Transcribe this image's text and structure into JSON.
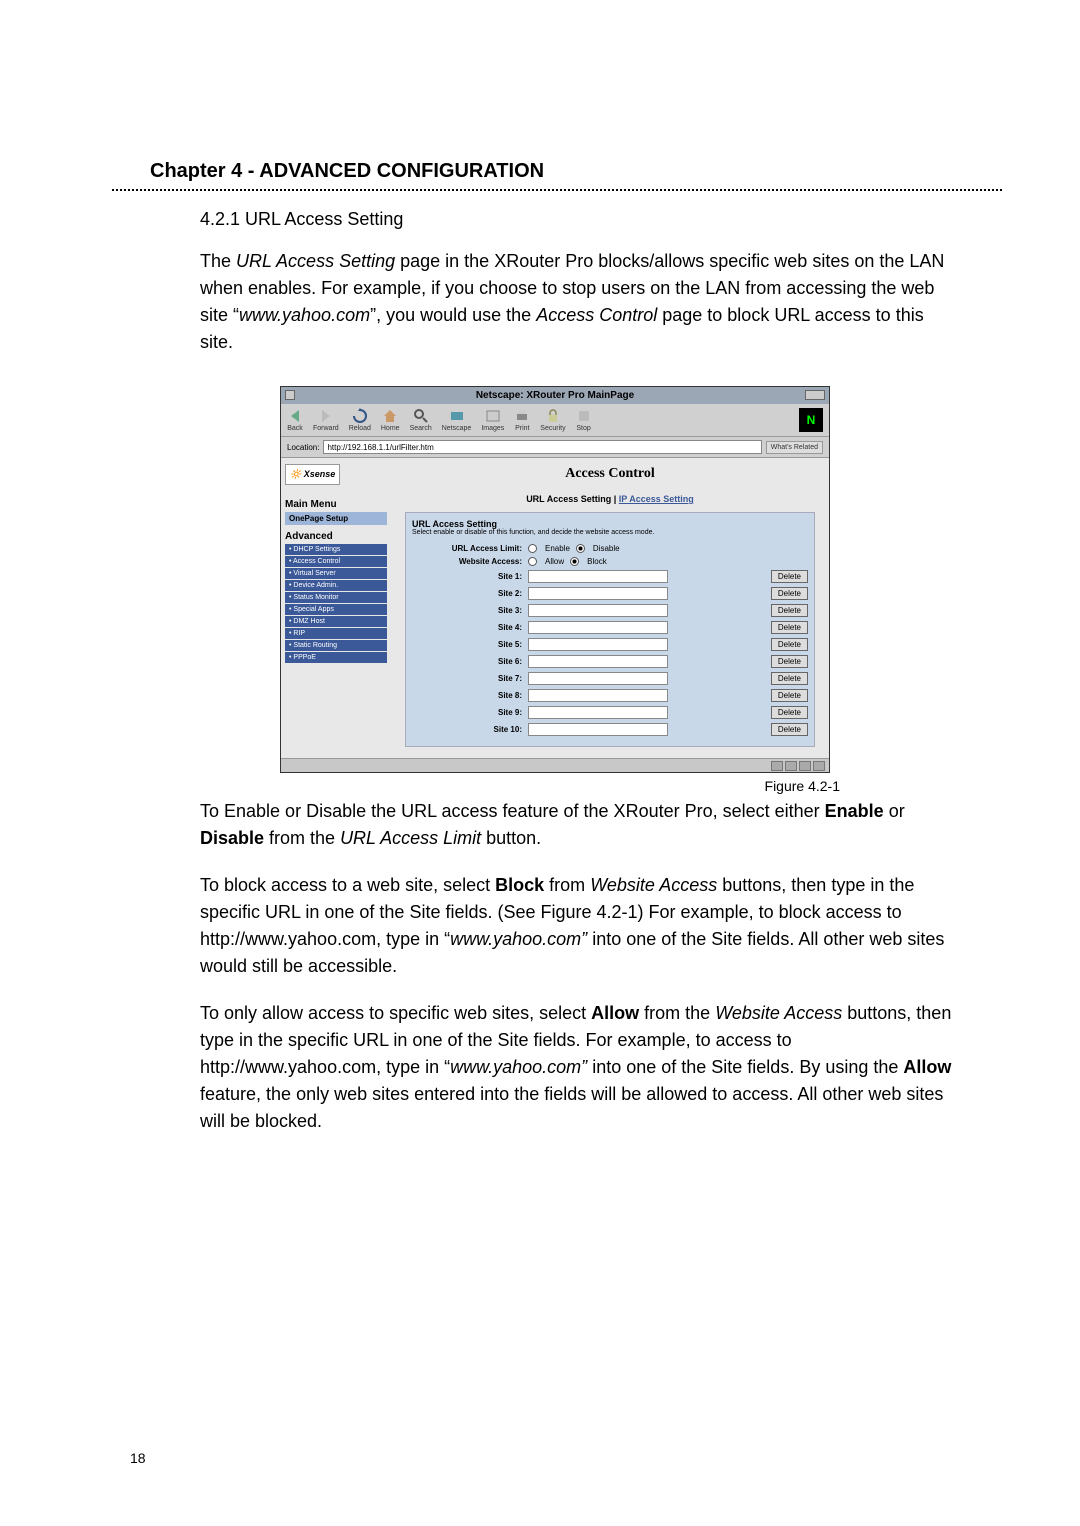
{
  "chapter": "Chapter 4 - ADVANCED CONFIGURATION",
  "section": "4.2.1  URL Access Setting",
  "para1_before": "The ",
  "para1_em1": "URL Access Setting",
  "para1_mid1": " page in the XRouter Pro blocks/allows specific web sites on the LAN when enables.  For example, if you choose to stop users on the LAN from accessing the web site “",
  "para1_em2": "www.yahoo.com",
  "para1_mid2": "”, you would use the ",
  "para1_em3": "Access Control",
  "para1_end": " page to block URL access to this site.",
  "figure_label": "Figure 4.2-1",
  "para2_before": "To Enable or Disable the URL access feature of the XRouter Pro, select either ",
  "para2_b1": "Enable",
  "para2_mid1": " or ",
  "para2_b2": "Disable",
  "para2_mid2": " from the ",
  "para2_em": "URL Access Limit",
  "para2_end": " button.",
  "para3_before": "To block access to a web site, select ",
  "para3_b": "Block",
  "para3_mid1": " from ",
  "para3_em1": "Website Access",
  "para3_mid2": " buttons, then type in the specific URL in one of the Site fields.   (See Figure 4.2-1) For example, to block access to http://www.yahoo.com, type in “",
  "para3_em2": "www.yahoo.com”",
  "para3_end": " into one of the Site fields.  All other web sites would still be accessible.",
  "para4_before": "To only allow access to specific web sites, select ",
  "para4_b1": "Allow",
  "para4_mid1": " from the ",
  "para4_em1": "Website Access",
  "para4_mid2": " buttons, then type in the specific URL in one of the Site fields. For example, to access to http://www.yahoo.com, type in “",
  "para4_em2": "www.yahoo.com”",
  "para4_mid3": " into one of the Site fields. By using the ",
  "para4_b2": "Allow",
  "para4_end": " feature, the only web sites entered into the fields will be allowed to access. All other web sites will be blocked.",
  "page_number": "18",
  "screenshot": {
    "window_title": "Netscape: XRouter Pro MainPage",
    "toolbar": [
      "Back",
      "Forward",
      "Reload",
      "Home",
      "Search",
      "Netscape",
      "Images",
      "Print",
      "Security",
      "Stop"
    ],
    "location_label": "Location:",
    "location_url": "http://192.168.1.1/urlFilter.htm",
    "whats_related": "What's Related",
    "xsense_brand": "Xsense",
    "main_menu": "Main Menu",
    "menu_sections": {
      "onepage": "OnePage Setup",
      "advanced": "Advanced"
    },
    "menu_items": [
      "DHCP Settings",
      "Access Control",
      "Virtual Server",
      "Device Admin.",
      "Status Monitor",
      "Special Apps",
      "DMZ Host",
      "RIP",
      "Static Routing",
      "PPPoE"
    ],
    "panel_title": "Access Control",
    "tab_active": "URL Access Setting",
    "tab_sep": " | ",
    "tab_inactive": "IP Access Setting",
    "url_box_title": "URL Access Setting",
    "url_box_hint": "Select enable or disable of this function, and decide the website access mode.",
    "label_limit": "URL Access Limit:",
    "opt_enable": "Enable",
    "opt_disable": "Disable",
    "label_website": "Website Access:",
    "opt_allow": "Allow",
    "opt_block": "Block",
    "sites": [
      "Site 1:",
      "Site 2:",
      "Site 3:",
      "Site 4:",
      "Site 5:",
      "Site 6:",
      "Site 7:",
      "Site 8:",
      "Site 9:",
      "Site 10:"
    ],
    "delete": "Delete"
  }
}
